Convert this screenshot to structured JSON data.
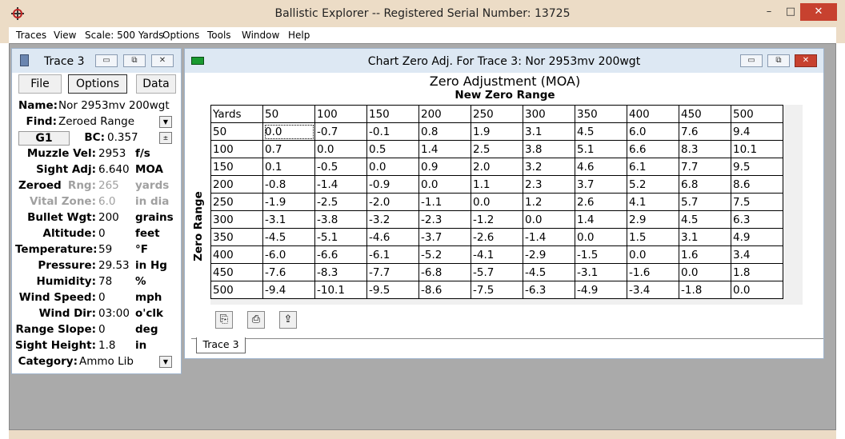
{
  "app": {
    "title": "Ballistic Explorer  --  Registered Serial Number: 13725",
    "icon": "target-icon",
    "window_buttons": {
      "minimize": "–",
      "maximize": "□",
      "close": "✕"
    }
  },
  "menubar": [
    "Traces",
    "View",
    "Scale: 500 Yards",
    "Options",
    "Tools",
    "Window",
    "Help"
  ],
  "trace_window": {
    "title": "Trace 3",
    "buttons": {
      "file": "File",
      "options": "Options",
      "data": "Data"
    },
    "fields": {
      "name_label": "Name:",
      "name_value": "Nor  2953mv 200wgt",
      "find_label": "Find:",
      "find_value": "Zeroed Range",
      "g1": "G1",
      "bc_label": "BC:",
      "bc_value": "0.357",
      "muzzle_label": "Muzzle Vel:",
      "muzzle_value": "2953",
      "muzzle_unit": "f/s",
      "sight_adj_label": "Sight Adj:",
      "sight_adj_value": "6.640",
      "sight_adj_unit": "MOA",
      "zeroed_label": "Zeroed",
      "rng_label": "Rng:",
      "rng_value": "265",
      "rng_unit": "yards",
      "vital_label": "Vital Zone:",
      "vital_value": "6.0",
      "vital_unit": "in dia",
      "bullet_label": "Bullet Wgt:",
      "bullet_value": "200",
      "bullet_unit": "grains",
      "altitude_label": "Altitude:",
      "altitude_value": "0",
      "altitude_unit": "feet",
      "temp_label": "Temperature:",
      "temp_value": "59",
      "temp_unit": "°F",
      "pressure_label": "Pressure:",
      "pressure_value": "29.53",
      "pressure_unit": "in Hg",
      "humidity_label": "Humidity:",
      "humidity_value": "78",
      "humidity_unit": "%",
      "wind_speed_label": "Wind Speed:",
      "wind_speed_value": "0",
      "wind_speed_unit": "mph",
      "wind_dir_label": "Wind Dir:",
      "wind_dir_value": "03:00",
      "wind_dir_unit": "o'clk",
      "range_slope_label": "Range Slope:",
      "range_slope_value": "0",
      "range_slope_unit": "deg",
      "sight_height_label": "Sight Height:",
      "sight_height_value": "1.8",
      "sight_height_unit": "in",
      "category_label": "Category:",
      "category_value": "Ammo Lib"
    }
  },
  "chart_window": {
    "title": "Chart Zero Adj. For Trace 3:  Nor  2953mv 200wgt",
    "heading": "Zero Adjustment (MOA)",
    "subheading": "New Zero Range",
    "y_label": "Zero Range",
    "corner": "Yards",
    "columns": [
      "50",
      "100",
      "150",
      "200",
      "250",
      "300",
      "350",
      "400",
      "450",
      "500"
    ],
    "rows": [
      {
        "label": "50",
        "values": [
          "0.0",
          "-0.7",
          "-0.1",
          "0.8",
          "1.9",
          "3.1",
          "4.5",
          "6.0",
          "7.6",
          "9.4"
        ]
      },
      {
        "label": "100",
        "values": [
          "0.7",
          "0.0",
          "0.5",
          "1.4",
          "2.5",
          "3.8",
          "5.1",
          "6.6",
          "8.3",
          "10.1"
        ]
      },
      {
        "label": "150",
        "values": [
          "0.1",
          "-0.5",
          "0.0",
          "0.9",
          "2.0",
          "3.2",
          "4.6",
          "6.1",
          "7.7",
          "9.5"
        ]
      },
      {
        "label": "200",
        "values": [
          "-0.8",
          "-1.4",
          "-0.9",
          "0.0",
          "1.1",
          "2.3",
          "3.7",
          "5.2",
          "6.8",
          "8.6"
        ]
      },
      {
        "label": "250",
        "values": [
          "-1.9",
          "-2.5",
          "-2.0",
          "-1.1",
          "0.0",
          "1.2",
          "2.6",
          "4.1",
          "5.7",
          "7.5"
        ]
      },
      {
        "label": "300",
        "values": [
          "-3.1",
          "-3.8",
          "-3.2",
          "-2.3",
          "-1.2",
          "0.0",
          "1.4",
          "2.9",
          "4.5",
          "6.3"
        ]
      },
      {
        "label": "350",
        "values": [
          "-4.5",
          "-5.1",
          "-4.6",
          "-3.7",
          "-2.6",
          "-1.4",
          "0.0",
          "1.5",
          "3.1",
          "4.9"
        ]
      },
      {
        "label": "400",
        "values": [
          "-6.0",
          "-6.6",
          "-6.1",
          "-5.2",
          "-4.1",
          "-2.9",
          "-1.5",
          "0.0",
          "1.6",
          "3.4"
        ]
      },
      {
        "label": "450",
        "values": [
          "-7.6",
          "-8.3",
          "-7.7",
          "-6.8",
          "-5.7",
          "-4.5",
          "-3.1",
          "-1.6",
          "0.0",
          "1.8"
        ]
      },
      {
        "label": "500",
        "values": [
          "-9.4",
          "-10.1",
          "-9.5",
          "-8.6",
          "-7.5",
          "-6.3",
          "-4.9",
          "-3.4",
          "-1.8",
          "0.0"
        ]
      }
    ],
    "tools": [
      "copy-icon",
      "print-icon",
      "export-icon"
    ],
    "tab": "Trace 3"
  }
}
